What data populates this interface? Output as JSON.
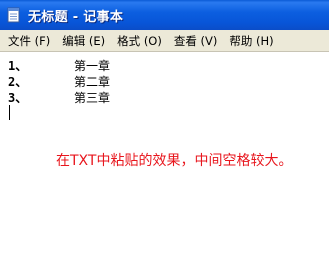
{
  "window": {
    "title": "无标题 - 记事本"
  },
  "menu": [
    {
      "label": "文件",
      "key": "(F)"
    },
    {
      "label": "编辑",
      "key": "(E)"
    },
    {
      "label": "格式",
      "key": "(O)"
    },
    {
      "label": "查看",
      "key": "(V)"
    },
    {
      "label": "帮助",
      "key": "(H)"
    }
  ],
  "document": {
    "lines": [
      {
        "num": "1、",
        "text": "第一章"
      },
      {
        "num": "2、",
        "text": "第二章"
      },
      {
        "num": "3、",
        "text": "第三章"
      }
    ]
  },
  "annotation": "在TXT中粘贴的效果，中间空格较大。",
  "colors": {
    "titlebar": "#0c5fe0",
    "menubar": "#ece9d8",
    "annotation": "#e8161d"
  },
  "icons": {
    "app": "notepad-icon"
  }
}
